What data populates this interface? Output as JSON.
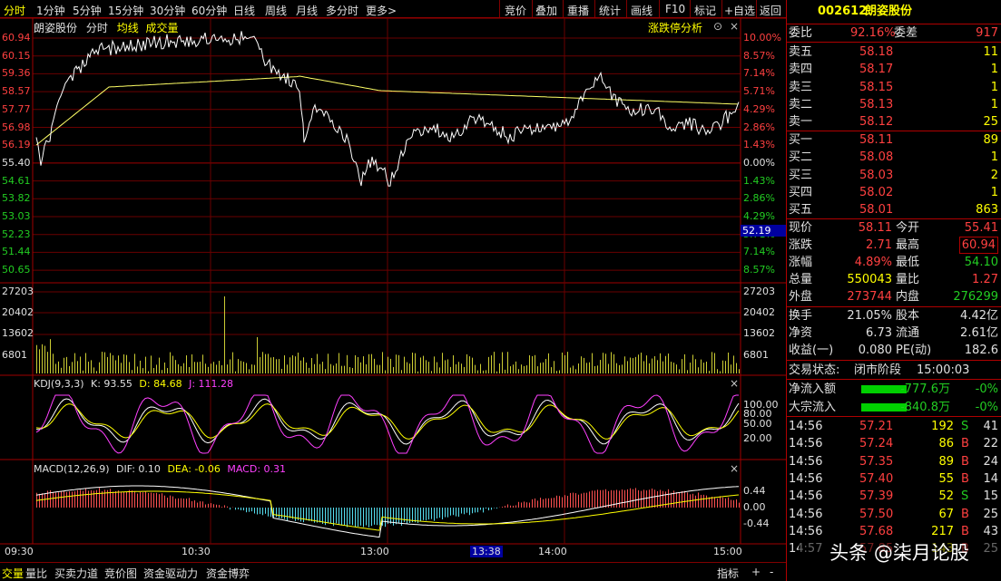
{
  "toolbar": {
    "tabs": [
      "分时",
      "1分钟",
      "5分钟",
      "15分钟",
      "30分钟",
      "60分钟",
      "日线",
      "周线",
      "月线",
      "多分时",
      "更多>"
    ],
    "buttons": [
      "竞价",
      "叠加",
      "重播",
      "统计",
      "画线",
      "F10",
      "标记",
      "+自选",
      "返回"
    ]
  },
  "chart_header": {
    "name": "朗姿股份",
    "mode": "分时",
    "avg_label": "均线",
    "vol_label": "成交量",
    "link": "涨跌停分析"
  },
  "price_axis": {
    "left": [
      "60.94",
      "60.15",
      "59.36",
      "58.57",
      "57.77",
      "56.98",
      "56.19",
      "55.40",
      "54.61",
      "53.82",
      "53.03",
      "52.23",
      "51.44",
      "50.65"
    ],
    "right": [
      "10.00%",
      "8.57%",
      "7.14%",
      "5.71%",
      "4.29%",
      "2.86%",
      "1.43%",
      "0.00%",
      "1.43%",
      "2.86%",
      "4.29%",
      "5.71%",
      "7.14%",
      "8.57%"
    ],
    "cursor_value": "52.19"
  },
  "volume_axis": {
    "left": [
      "27203",
      "20402",
      "13602",
      "6801"
    ],
    "right": [
      "27203",
      "20402",
      "13602",
      "6801"
    ]
  },
  "kdj": {
    "label": "KDJ(9,3,3)",
    "k": "K: 93.55",
    "d": "D: 84.68",
    "j": "J: 111.28",
    "levels": [
      "100.00",
      "80.00",
      "50.00",
      "20.00"
    ]
  },
  "macd": {
    "label": "MACD(12,26,9)",
    "dif": "DIF: 0.10",
    "dea": "DEA: -0.06",
    "macd": "MACD: 0.31",
    "levels": [
      "0.44",
      "0.00",
      "-0.44"
    ]
  },
  "time_axis": [
    "09:30",
    "10:30",
    "13:00",
    "14:00",
    "15:00"
  ],
  "time_cursor": "13:38",
  "bottom_tabs": [
    "交量",
    "量比",
    "买卖力道",
    "竞价图",
    "资金驱动力",
    "资金博弈"
  ],
  "bottom_right": "指标",
  "stock": {
    "code": "002612",
    "name": "朗姿股份"
  },
  "ratio": {
    "wb_label": "委比",
    "wb": "92.16%",
    "wc_label": "委差",
    "wc": "917"
  },
  "sell": [
    {
      "label": "卖五",
      "price": "58.18",
      "vol": "11"
    },
    {
      "label": "卖四",
      "price": "58.17",
      "vol": "1"
    },
    {
      "label": "卖三",
      "price": "58.15",
      "vol": "1"
    },
    {
      "label": "卖二",
      "price": "58.13",
      "vol": "1"
    },
    {
      "label": "卖一",
      "price": "58.12",
      "vol": "25"
    }
  ],
  "buy": [
    {
      "label": "买一",
      "price": "58.11",
      "vol": "89"
    },
    {
      "label": "买二",
      "price": "58.08",
      "vol": "1"
    },
    {
      "label": "买三",
      "price": "58.03",
      "vol": "2"
    },
    {
      "label": "买四",
      "price": "58.02",
      "vol": "1"
    },
    {
      "label": "买五",
      "price": "58.01",
      "vol": "863"
    }
  ],
  "quote": [
    {
      "l1": "现价",
      "v1": "58.11",
      "l2": "今开",
      "v2": "55.41"
    },
    {
      "l1": "涨跌",
      "v1": "2.71",
      "l2": "最高",
      "v2": "60.94"
    },
    {
      "l1": "涨幅",
      "v1": "4.89%",
      "l2": "最低",
      "v2": "54.10"
    },
    {
      "l1": "总量",
      "v1": "550043",
      "l2": "量比",
      "v2": "1.27"
    },
    {
      "l1": "外盘",
      "v1": "273744",
      "l2": "内盘",
      "v2": "276299"
    },
    {
      "l1": "换手",
      "v1": "21.05%",
      "l2": "股本",
      "v2": "4.42亿"
    },
    {
      "l1": "净资",
      "v1": "6.73",
      "l2": "流通",
      "v2": "2.61亿"
    },
    {
      "l1": "收益(一)",
      "v1": "0.080",
      "l2": "PE(动)",
      "v2": "182.6"
    }
  ],
  "status": {
    "label": "交易状态:",
    "value": "闭市阶段",
    "time": "15:00:03"
  },
  "flows": [
    {
      "label": "净流入额",
      "value": "-777.6万",
      "pct": "-0%"
    },
    {
      "label": "大宗流入",
      "value": "-840.8万",
      "pct": "-0%"
    }
  ],
  "ticks": [
    {
      "t": "14:56",
      "p": "57.21",
      "v": "192",
      "s": "S",
      "n": "41"
    },
    {
      "t": "14:56",
      "p": "57.24",
      "v": "86",
      "s": "B",
      "n": "22"
    },
    {
      "t": "14:56",
      "p": "57.35",
      "v": "89",
      "s": "B",
      "n": "24"
    },
    {
      "t": "14:56",
      "p": "57.40",
      "v": "55",
      "s": "B",
      "n": "14"
    },
    {
      "t": "14:56",
      "p": "57.39",
      "v": "52",
      "s": "S",
      "n": "15"
    },
    {
      "t": "14:56",
      "p": "57.50",
      "v": "67",
      "s": "B",
      "n": "25"
    },
    {
      "t": "14:56",
      "p": "57.68",
      "v": "217",
      "s": "B",
      "n": "43"
    },
    {
      "t": "14:57",
      "p": "57.85",
      "v": "143",
      "s": "B",
      "n": "25"
    }
  ],
  "watermark": "头条 @柒月论股"
}
